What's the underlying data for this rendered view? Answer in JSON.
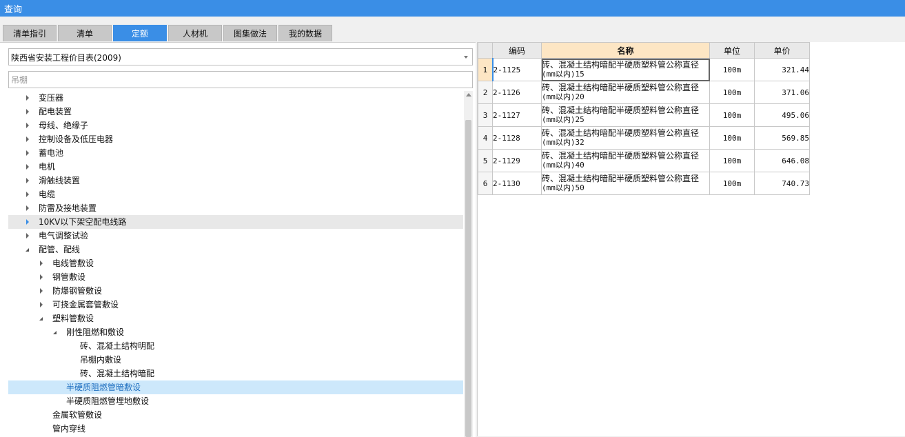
{
  "window": {
    "title": "查询"
  },
  "tabs": [
    {
      "label": "清单指引",
      "active": false
    },
    {
      "label": "清单",
      "active": false
    },
    {
      "label": "定额",
      "active": true
    },
    {
      "label": "人材机",
      "active": false
    },
    {
      "label": "图集做法",
      "active": false
    },
    {
      "label": "我的数据",
      "active": false
    }
  ],
  "library_select": {
    "value": "陕西省安装工程价目表(2009)"
  },
  "search": {
    "placeholder": "吊棚"
  },
  "tree": [
    {
      "label": "变压器",
      "level": 0,
      "expander": "closed"
    },
    {
      "label": "配电装置",
      "level": 0,
      "expander": "closed"
    },
    {
      "label": "母线、绝缘子",
      "level": 0,
      "expander": "closed"
    },
    {
      "label": "控制设备及低压电器",
      "level": 0,
      "expander": "closed"
    },
    {
      "label": "蓄电池",
      "level": 0,
      "expander": "closed"
    },
    {
      "label": "电机",
      "level": 0,
      "expander": "closed"
    },
    {
      "label": "滑触线装置",
      "level": 0,
      "expander": "closed"
    },
    {
      "label": "电缆",
      "level": 0,
      "expander": "closed"
    },
    {
      "label": "防雷及接地装置",
      "level": 0,
      "expander": "closed"
    },
    {
      "label": "10KV以下架空配电线路",
      "level": 0,
      "expander": "closed",
      "state": "hover"
    },
    {
      "label": "电气调整试验",
      "level": 0,
      "expander": "closed"
    },
    {
      "label": "配管、配线",
      "level": 0,
      "expander": "open"
    },
    {
      "label": "电线管敷设",
      "level": 1,
      "expander": "closed"
    },
    {
      "label": "钢管敷设",
      "level": 1,
      "expander": "closed"
    },
    {
      "label": "防爆钢管敷设",
      "level": 1,
      "expander": "closed"
    },
    {
      "label": "可挠金属套管敷设",
      "level": 1,
      "expander": "closed"
    },
    {
      "label": "塑料管敷设",
      "level": 1,
      "expander": "open"
    },
    {
      "label": "刚性阻燃和敷设",
      "level": 2,
      "expander": "open"
    },
    {
      "label": "砖、混凝土结构明配",
      "level": 3,
      "expander": "none"
    },
    {
      "label": "吊棚内敷设",
      "level": 3,
      "expander": "none"
    },
    {
      "label": "砖、混凝土结构暗配",
      "level": 3,
      "expander": "none"
    },
    {
      "label": "半硬质阻燃管暗敷设",
      "level": 2,
      "expander": "none",
      "state": "selected"
    },
    {
      "label": "半硬质阻燃管埋地敷设",
      "level": 2,
      "expander": "none"
    },
    {
      "label": "金属软管敷设",
      "level": 1,
      "expander": "none"
    },
    {
      "label": "管内穿线",
      "level": 1,
      "expander": "none"
    }
  ],
  "grid": {
    "columns": [
      "编码",
      "名称",
      "单位",
      "单价"
    ],
    "rows": [
      {
        "no": "1",
        "code": "2-1125",
        "name": "砖、混凝土结构暗配半硬质塑料管公称直径",
        "name2": "(mm以内)15",
        "unit": "100m",
        "price": "321.44"
      },
      {
        "no": "2",
        "code": "2-1126",
        "name": "砖、混凝土结构暗配半硬质塑料管公称直径",
        "name2": "(mm以内)20",
        "unit": "100m",
        "price": "371.06"
      },
      {
        "no": "3",
        "code": "2-1127",
        "name": "砖、混凝土结构暗配半硬质塑料管公称直径",
        "name2": "(mm以内)25",
        "unit": "100m",
        "price": "495.06"
      },
      {
        "no": "4",
        "code": "2-1128",
        "name": "砖、混凝土结构暗配半硬质塑料管公称直径",
        "name2": "(mm以内)32",
        "unit": "100m",
        "price": "569.85"
      },
      {
        "no": "5",
        "code": "2-1129",
        "name": "砖、混凝土结构暗配半硬质塑料管公称直径",
        "name2": "(mm以内)40",
        "unit": "100m",
        "price": "646.08"
      },
      {
        "no": "6",
        "code": "2-1130",
        "name": "砖、混凝土结构暗配半硬质塑料管公称直径",
        "name2": "(mm以内)50",
        "unit": "100m",
        "price": "740.73"
      }
    ]
  },
  "colors": {
    "accent": "#3a8ee6",
    "highlight_header": "#fde6c4",
    "selected_row": "#cde8fb"
  }
}
